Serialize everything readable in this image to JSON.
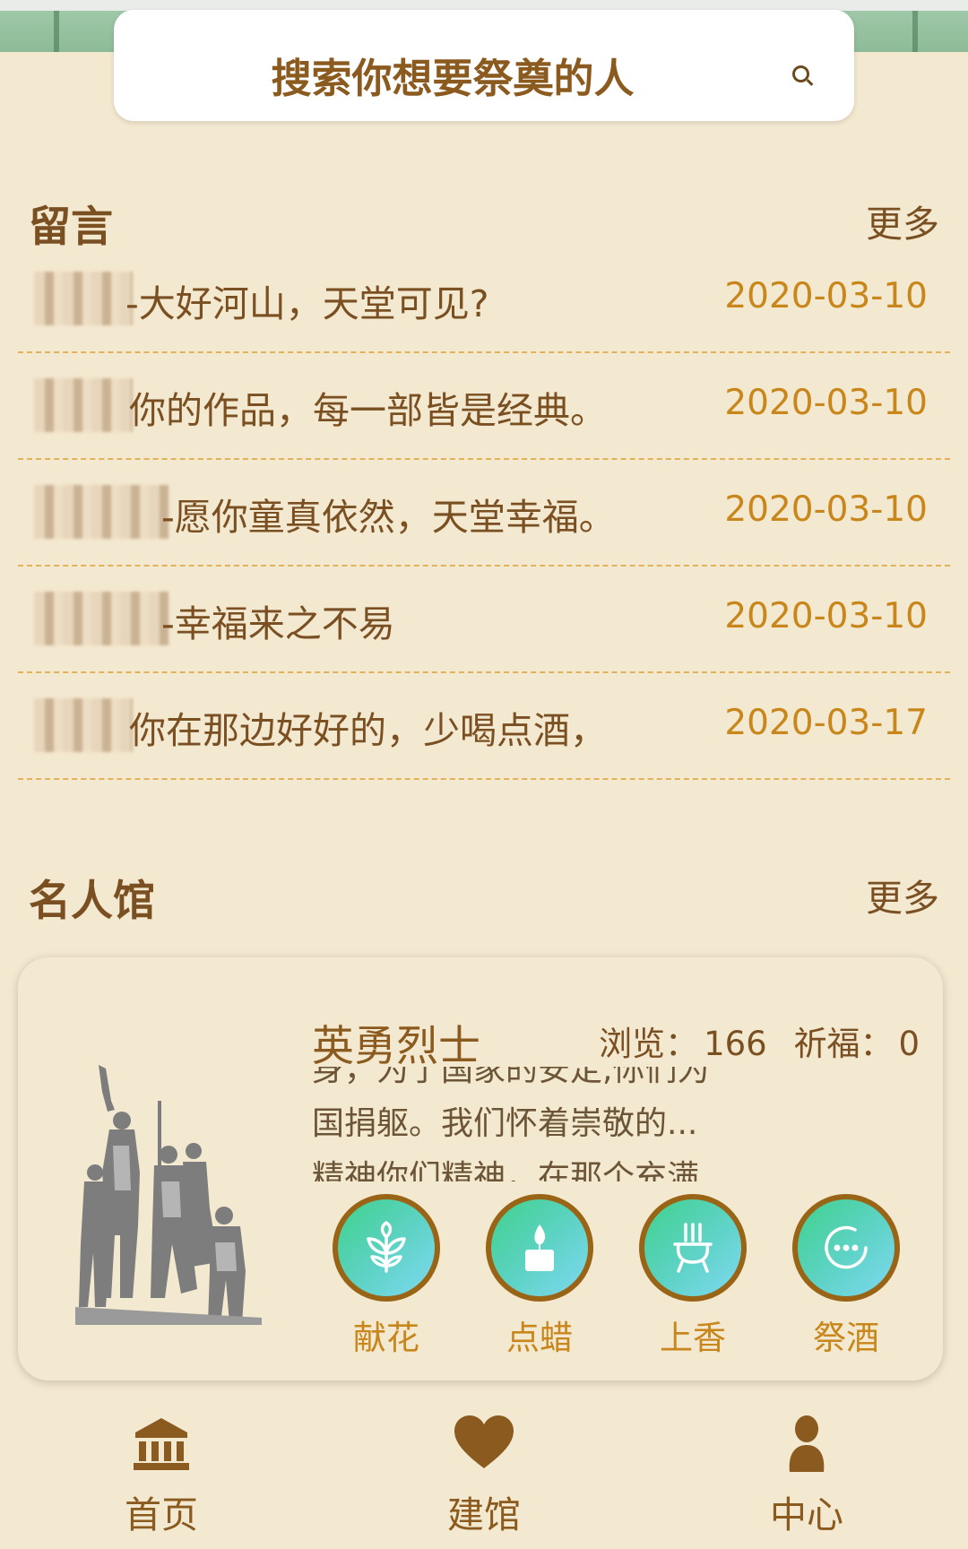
{
  "search": {
    "placeholder": "搜索你想要祭奠的人"
  },
  "messages_section": {
    "title": "留言",
    "more": "更多",
    "items": [
      {
        "text": "-大好河山，天堂可见?",
        "date": "2020-03-10"
      },
      {
        "text": "你的作品，每一部皆是经典。",
        "date": "2020-03-10"
      },
      {
        "text": "-愿你童真依然，天堂幸福。",
        "date": "2020-03-10"
      },
      {
        "text": "-幸福来之不易",
        "date": "2020-03-10"
      },
      {
        "text": "你在那边好好的，少喝点酒，",
        "date": "2020-03-17"
      }
    ]
  },
  "celebrity_section": {
    "title": "名人馆",
    "more": "更多",
    "card": {
      "name": "英勇烈士",
      "views_label": "浏览：",
      "views": "166",
      "prayers_label": "祈福：",
      "prayers": "0",
      "description_lines": [
        "身，为了国家的安定,你们为",
        "国捐躯。我们怀着崇敬的...",
        "精神你们精神，在那个充满"
      ],
      "actions": [
        {
          "label": "献花",
          "icon": "flower-icon"
        },
        {
          "label": "点蜡",
          "icon": "candle-icon"
        },
        {
          "label": "上香",
          "icon": "incense-icon"
        },
        {
          "label": "祭酒",
          "icon": "more-icon"
        }
      ]
    }
  },
  "bottom_nav": {
    "items": [
      {
        "label": "首页",
        "icon": "museum-icon"
      },
      {
        "label": "建馆",
        "icon": "heart-icon"
      },
      {
        "label": "中心",
        "icon": "person-icon"
      }
    ]
  },
  "colors": {
    "background": "#f3e8d0",
    "accent_brown": "#8b5a1f",
    "date_gold": "#c8861b",
    "action_border": "#9a6416"
  }
}
